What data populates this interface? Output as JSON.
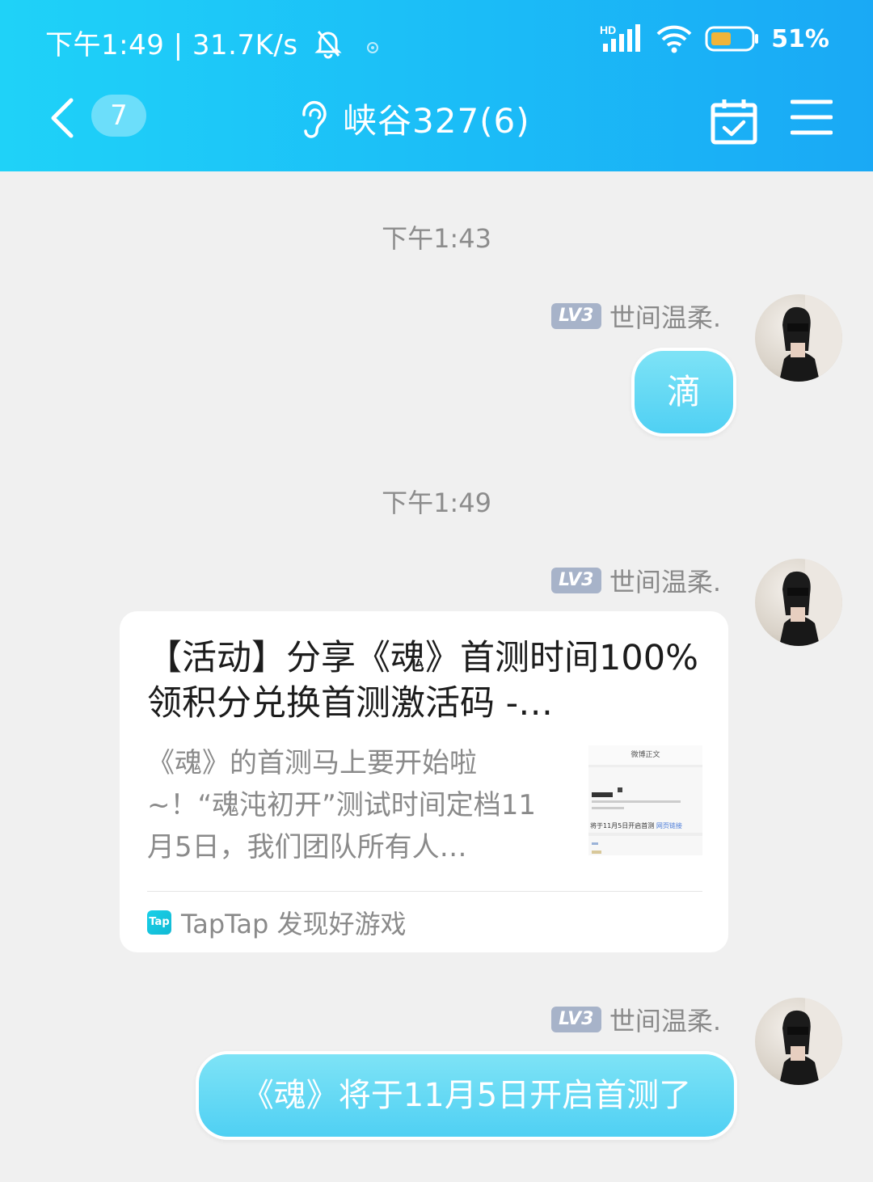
{
  "status_bar": {
    "time_speed": "下午1:49 | 31.7K/s",
    "network": "HD",
    "battery": "51%"
  },
  "nav": {
    "unread_count": "7",
    "title": "峡谷327(6)"
  },
  "messages": [
    {
      "timestamp": "下午1:43",
      "level": "LV3",
      "sender": "世间温柔.",
      "text": "滴"
    },
    {
      "timestamp": "下午1:49",
      "level": "LV3",
      "sender": "世间温柔.",
      "card": {
        "title": "【活动】分享《魂》首测时间100%领积分兑换首测激活码 -…",
        "description": "《魂》的首测马上要开始啦~！“魂沌初开”测试时间定档11月5日，我们团队所有人…",
        "thumbnail_header": "微博正文",
        "thumbnail_line": "将于11月5日开启首测",
        "thumbnail_link": "网页链接",
        "source_logo": "Tap",
        "source": "TapTap 发现好游戏"
      }
    },
    {
      "level": "LV3",
      "sender": "世间温柔.",
      "text": "《魂》将于11月5日开启首测了"
    }
  ],
  "colors": {
    "header_start": "#1fd2f8",
    "header_end": "#1aa9f5",
    "bubble": "#4fd0f3",
    "level_badge": "#a7b3c9",
    "background": "#f0f0f0"
  },
  "icons": [
    "back-icon",
    "ear-icon",
    "calendar-check-icon",
    "menu-icon",
    "bell-off-icon",
    "signal-icon",
    "wifi-icon",
    "battery-icon"
  ]
}
